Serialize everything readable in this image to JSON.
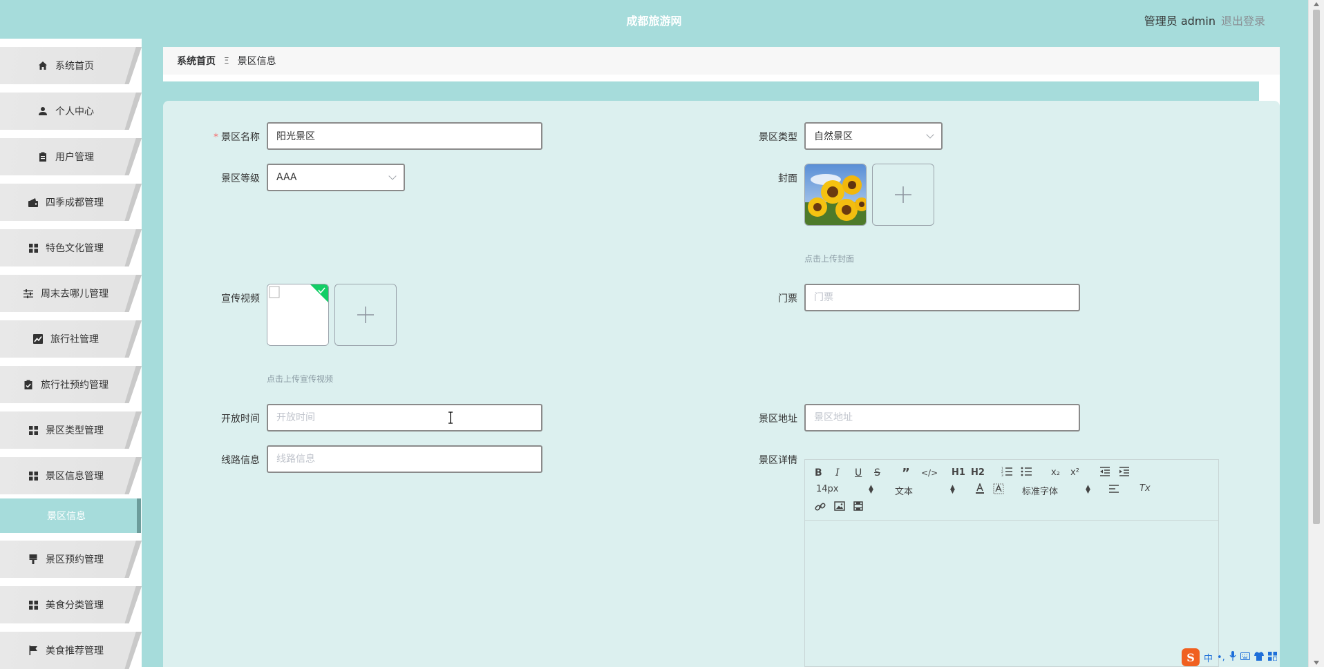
{
  "header": {
    "site_title": "成都旅游网",
    "admin_text": "管理员 admin",
    "logout_text": "退出登录"
  },
  "colors": {
    "accent": "#a6dcdb",
    "panel_bg": "#dcf0ef",
    "required": "#f56c6c"
  },
  "sidebar": {
    "items": [
      {
        "label": "系统首页",
        "icon": "home-icon"
      },
      {
        "label": "个人中心",
        "icon": "user-icon"
      },
      {
        "label": "用户管理",
        "icon": "clipboard-icon"
      },
      {
        "label": "四季成都管理",
        "icon": "wallet-icon"
      },
      {
        "label": "特色文化管理",
        "icon": "grid-icon"
      },
      {
        "label": "周末去哪儿管理",
        "icon": "sliders-icon"
      },
      {
        "label": "旅行社管理",
        "icon": "chart-icon"
      },
      {
        "label": "旅行社预约管理",
        "icon": "checklist-icon"
      },
      {
        "label": "景区类型管理",
        "icon": "grid-icon"
      },
      {
        "label": "景区信息管理",
        "icon": "grid-icon"
      },
      {
        "label": "景区信息",
        "icon": "",
        "active": true
      },
      {
        "label": "景区预约管理",
        "icon": "brush-icon"
      },
      {
        "label": "美食分类管理",
        "icon": "grid-icon"
      },
      {
        "label": "美食推荐管理",
        "icon": "flag-icon"
      }
    ]
  },
  "breadcrumb": {
    "home": "系统首页",
    "separator": "Ξ",
    "current": "景区信息"
  },
  "form": {
    "name": {
      "label": "景区名称",
      "value": "阳光景区",
      "required_mark": "*"
    },
    "type": {
      "label": "景区类型",
      "value": "自然景区"
    },
    "level": {
      "label": "景区等级",
      "value": "AAA"
    },
    "cover": {
      "label": "封面",
      "hint": "点击上传封面"
    },
    "video": {
      "label": "宣传视频",
      "hint": "点击上传宣传视频"
    },
    "ticket": {
      "label": "门票",
      "placeholder": "门票"
    },
    "open_time": {
      "label": "开放时间",
      "placeholder": "开放时间"
    },
    "address": {
      "label": "景区地址",
      "placeholder": "景区地址"
    },
    "route": {
      "label": "线路信息",
      "placeholder": "线路信息"
    },
    "details": {
      "label": "景区详情"
    }
  },
  "editor_toolbar": {
    "font_size": "14px",
    "text_style": "文本",
    "font_family": "标准字体",
    "buttons_row1": [
      "bold",
      "italic",
      "underline",
      "strike",
      "blockquote",
      "code-block",
      "h1",
      "h2",
      "ordered-list",
      "bullet-list",
      "subscript",
      "superscript",
      "outdent",
      "indent"
    ],
    "buttons_row3": [
      "link",
      "image",
      "video"
    ],
    "h1": "H1",
    "h2": "H2",
    "bold": "B",
    "italic": "I",
    "underline": "U",
    "strike": "S",
    "sub": "x₂",
    "sup": "x²",
    "clear": "Tx"
  },
  "ime": {
    "logo": "S",
    "mode": "中",
    "punct": "•,"
  }
}
